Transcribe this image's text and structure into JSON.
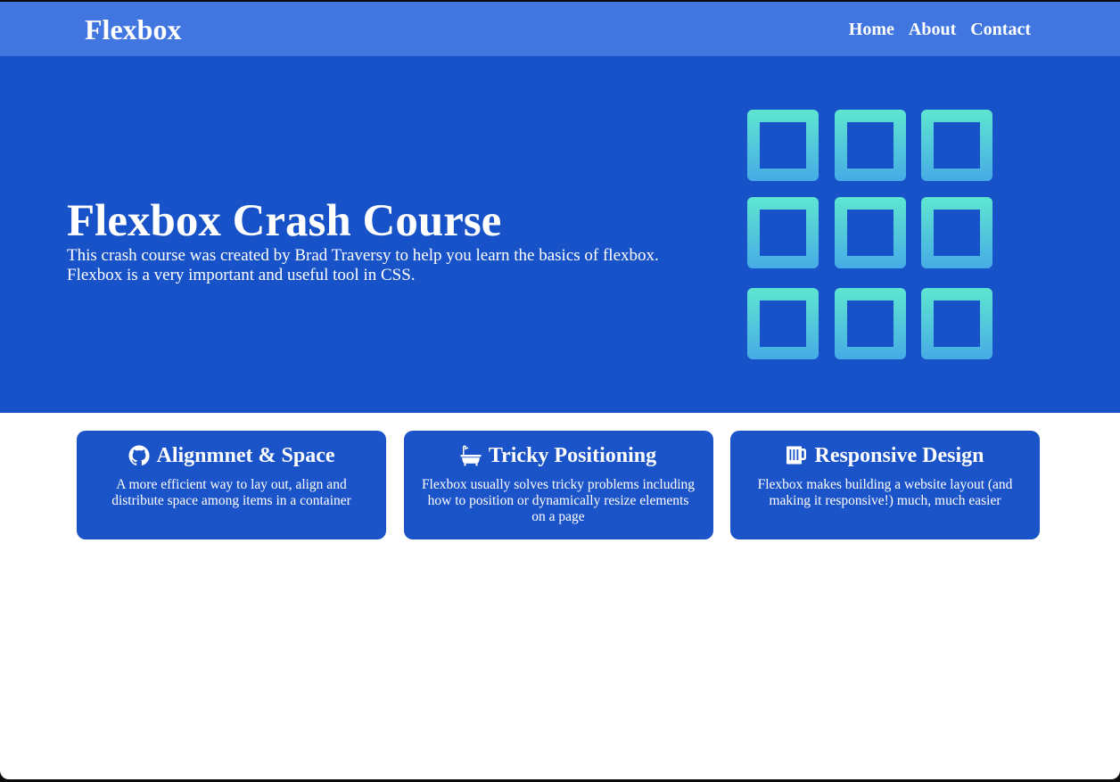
{
  "navbar": {
    "logo": "Flexbox",
    "links": [
      "Home",
      "About",
      "Contact"
    ]
  },
  "hero": {
    "title": "Flexbox Crash Course",
    "text": "This crash course was created by Brad Traversy to help you learn the basics of flexbox. Flexbox is a very important and useful tool in CSS.",
    "graphic_icon": "grid-icon"
  },
  "boxes": [
    {
      "icon": "github-icon",
      "heading": "Alignmnet & Space",
      "text": "A more efficient way to lay out, align and distribute space among items in a container"
    },
    {
      "icon": "bath-icon",
      "heading": "Tricky Positioning",
      "text": "Flexbox usually solves tricky problems including how to position or dynamically resize elements on a page"
    },
    {
      "icon": "beer-mug-icon",
      "heading": "Responsive Design",
      "text": "Flexbox makes building a website layout (and making it responsive!) much, much easier"
    }
  ],
  "colors": {
    "navbar": "#4176e0",
    "hero": "#1852c9",
    "box": "#1b53c8",
    "grid_gradient_top": "#5ee6d0",
    "grid_gradient_bottom": "#47abe6"
  }
}
